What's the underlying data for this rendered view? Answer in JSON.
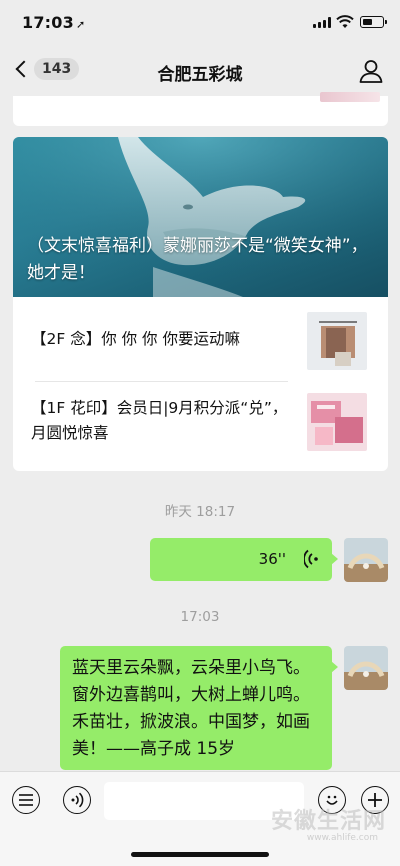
{
  "status_bar": {
    "time": "17:03",
    "location_arrow": "➚",
    "battery_level": 0.55
  },
  "nav": {
    "unread_count": "143",
    "title": "合肥五彩城",
    "back_icon": "chevron-left-icon",
    "profile_icon": "person-icon"
  },
  "article": {
    "headline": "（文末惊喜福利）蒙娜丽莎不是“微笑女神”，她才是！",
    "items": [
      {
        "title": "【2F 念】你 你 你 你要运动嘛"
      },
      {
        "title": "【1F 花印】会员日|9月积分派“兑”，月圆悦惊喜"
      }
    ]
  },
  "chat": {
    "timestamp_1": "昨天 18:17",
    "voice_duration": "36''",
    "timestamp_2": "17:03",
    "text_message": "蓝天里云朵飘，云朵里小鸟飞。窗外边喜鹊叫，大树上蝉儿鸣。禾苗壮，掀波浪。中国梦，如画美！——高子成 15岁",
    "bubble_color": "#95ec69"
  },
  "input_bar": {
    "menu_icon": "menu-list-icon",
    "voice_icon": "voice-input-icon",
    "emoji_icon": "emoji-icon",
    "add_icon": "plus-icon"
  },
  "watermark": {
    "text": "安徽生活网",
    "url": "www.ahlife.com"
  }
}
